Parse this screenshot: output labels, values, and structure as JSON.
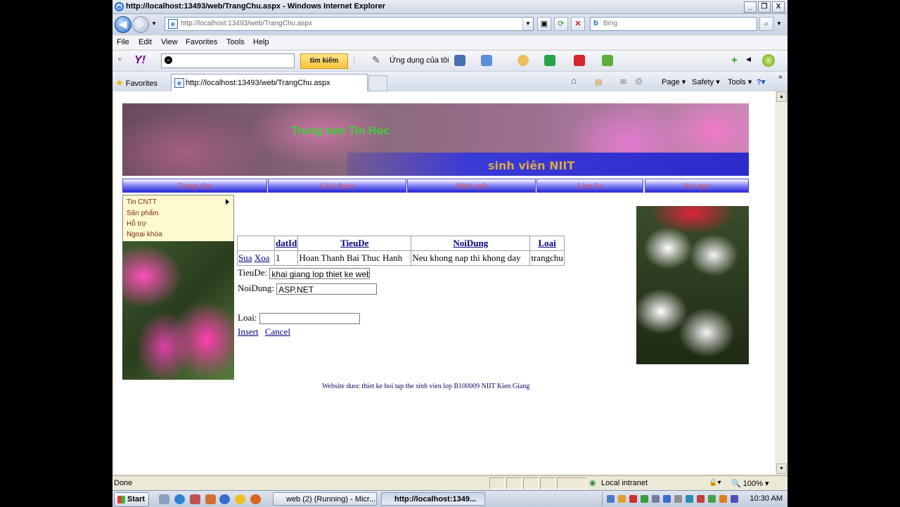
{
  "window": {
    "title": "http://localhost:13493/web/TrangChu.aspx - Windows Internet Explorer",
    "controls": [
      "_",
      "❐",
      "X"
    ]
  },
  "address": {
    "url": "http://localhost:13493/web/TrangChu.aspx",
    "search_placeholder": "Bing"
  },
  "menubar": [
    "File",
    "Edit",
    "View",
    "Favorites",
    "Tools",
    "Help"
  ],
  "yahoo_toolbar": {
    "logo": "Y!",
    "search_button": "tìm kiếm",
    "apps_label": "Ứng dụng của tôi"
  },
  "favorites_bar": {
    "favorites_label": "Favorites",
    "tab_title": "http://localhost:13493/web/TrangChu.aspx",
    "commands": [
      "Page",
      "Safety",
      "Tools"
    ]
  },
  "page": {
    "banner_title": "Trung tam Tin Hoc",
    "banner_subtitle": "sinh viên NIIT",
    "nav": [
      "Trang chu",
      "Gioi thieu",
      "Hinh anh",
      "Lien he",
      "Noi quy"
    ],
    "flyout": [
      "Tin CNTT",
      "Sản phẩm",
      "Hỗ trợ",
      "Ngoại khóa"
    ],
    "grid": {
      "headers": [
        "",
        "datId",
        "TieuDe",
        "NoiDung",
        "Loai"
      ],
      "rows": [
        {
          "actions": [
            "Sua",
            "Xoa"
          ],
          "datId": "1",
          "TieuDe": "Hoan Thanh Bai Thuc Hanh",
          "NoiDung": "Neu khong nap thi khong day",
          "Loai": "trangchu"
        }
      ]
    },
    "form": {
      "tieude_label": "TieuDe:",
      "tieude_value": "khai giang lop thiet ke web",
      "noidung_label": "NoiDung:",
      "noidung_value": "ASP.NET",
      "loai_label": "Loai:",
      "loai_value": "",
      "insert": "Insert",
      "cancel": "Cancel"
    },
    "footer": "Website duoc thiet ke boi tap the sinh vien lop B100009 NIIT Kien Giang"
  },
  "status": {
    "text": "Done",
    "zone": "Local intranet",
    "zoom": "100%"
  },
  "taskbar": {
    "start": "Start",
    "items": [
      "web (2) (Running) - Micr...",
      "http://localhost:1349..."
    ],
    "clock": "10:30 AM"
  }
}
